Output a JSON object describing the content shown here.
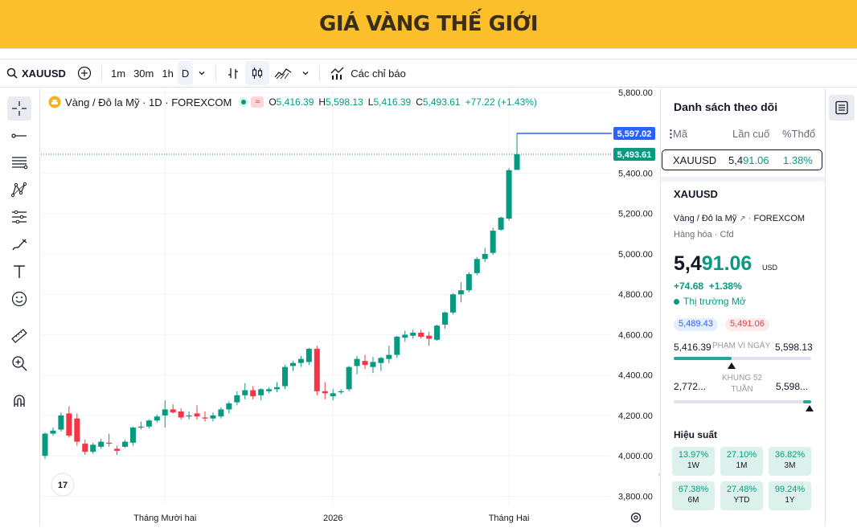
{
  "banner": {
    "title": "GIÁ VÀNG THẾ GIỚI"
  },
  "toolbar": {
    "symbol": "XAUUSD",
    "intervals": [
      "1m",
      "30m",
      "1h",
      "D"
    ],
    "active_interval": "D",
    "indicators_label": "Các chỉ báo"
  },
  "legend": {
    "title": "Vàng / Đô la Mỹ · 1D · FOREXCOM",
    "o_label": "O",
    "o": "5,416.39",
    "h_label": "H",
    "h": "5,598.13",
    "l_label": "L",
    "l": "5,416.39",
    "c_label": "C",
    "c": "5,493.61",
    "change": "+77.22 (+1.43%)"
  },
  "colors": {
    "up": "#089981",
    "down": "#f23645",
    "high_line": "#2962ff",
    "banner": "#fbbf2b"
  },
  "chart_data": {
    "type": "candlestick",
    "ylim": [
      3750,
      5820
    ],
    "y_ticks": [
      3800,
      4000,
      4200,
      4400,
      4600,
      4800,
      5000,
      5200,
      5400,
      5800
    ],
    "y_tick_labels": [
      "3,800.00",
      "4,000.00",
      "4,200.00",
      "4,400.00",
      "4,600.00",
      "4,800.00",
      "5,000.00",
      "5,200.00",
      "5,400.00",
      "5,800.00"
    ],
    "x_labels": [
      {
        "label": "Tháng Mười hai",
        "index": 15
      },
      {
        "label": "2026",
        "index": 36
      },
      {
        "label": "Tháng Hai",
        "index": 58
      }
    ],
    "price_markers": [
      {
        "label": "5,597.02",
        "value": 5597,
        "color": "#2962ff",
        "kind": "line"
      },
      {
        "label": "5,493.61",
        "value": 5493.6,
        "color": "#089981",
        "kind": "dotted"
      }
    ],
    "ohlc": [
      [
        4000,
        4115,
        3985,
        4110
      ],
      [
        4110,
        4140,
        4100,
        4125
      ],
      [
        4130,
        4215,
        4120,
        4200
      ],
      [
        4210,
        4245,
        4090,
        4100
      ],
      [
        4185,
        4210,
        4050,
        4070
      ],
      [
        4060,
        4080,
        4005,
        4020
      ],
      [
        4020,
        4065,
        4010,
        4055
      ],
      [
        4045,
        4085,
        4035,
        4070
      ],
      [
        4065,
        4110,
        4045,
        4060
      ],
      [
        4035,
        4050,
        4005,
        4025
      ],
      [
        4045,
        4080,
        4040,
        4070
      ],
      [
        4065,
        4145,
        4050,
        4140
      ],
      [
        4140,
        4170,
        4130,
        4145
      ],
      [
        4145,
        4180,
        4135,
        4175
      ],
      [
        4175,
        4205,
        4165,
        4195
      ],
      [
        4200,
        4275,
        4140,
        4230
      ],
      [
        4230,
        4255,
        4210,
        4215
      ],
      [
        4220,
        4235,
        4180,
        4190
      ],
      [
        4195,
        4220,
        4180,
        4200
      ],
      [
        4210,
        4250,
        4180,
        4195
      ],
      [
        4190,
        4220,
        4170,
        4185
      ],
      [
        4185,
        4215,
        4170,
        4200
      ],
      [
        4195,
        4240,
        4185,
        4230
      ],
      [
        4230,
        4270,
        4210,
        4260
      ],
      [
        4265,
        4320,
        4250,
        4300
      ],
      [
        4300,
        4360,
        4280,
        4325
      ],
      [
        4325,
        4345,
        4280,
        4295
      ],
      [
        4300,
        4335,
        4275,
        4330
      ],
      [
        4320,
        4340,
        4310,
        4330
      ],
      [
        4330,
        4365,
        4315,
        4340
      ],
      [
        4345,
        4450,
        4330,
        4440
      ],
      [
        4445,
        4470,
        4420,
        4460
      ],
      [
        4460,
        4495,
        4440,
        4480
      ],
      [
        4465,
        4535,
        4450,
        4530
      ],
      [
        4530,
        4545,
        4300,
        4320
      ],
      [
        4320,
        4365,
        4280,
        4310
      ],
      [
        4295,
        4330,
        4275,
        4310
      ],
      [
        4315,
        4330,
        4305,
        4320
      ],
      [
        4330,
        4445,
        4320,
        4440
      ],
      [
        4445,
        4495,
        4405,
        4480
      ],
      [
        4470,
        4500,
        4430,
        4450
      ],
      [
        4440,
        4490,
        4410,
        4465
      ],
      [
        4460,
        4490,
        4420,
        4485
      ],
      [
        4480,
        4545,
        4460,
        4500
      ],
      [
        4500,
        4595,
        4485,
        4590
      ],
      [
        4585,
        4620,
        4565,
        4600
      ],
      [
        4595,
        4625,
        4580,
        4610
      ],
      [
        4610,
        4625,
        4580,
        4590
      ],
      [
        4595,
        4615,
        4545,
        4580
      ],
      [
        4575,
        4650,
        4570,
        4645
      ],
      [
        4650,
        4715,
        4630,
        4710
      ],
      [
        4710,
        4805,
        4700,
        4800
      ],
      [
        4800,
        4860,
        4760,
        4820
      ],
      [
        4820,
        4910,
        4810,
        4900
      ],
      [
        4905,
        4985,
        4895,
        4975
      ],
      [
        4975,
        5030,
        4960,
        5000
      ],
      [
        5005,
        5130,
        4995,
        5115
      ],
      [
        5120,
        5185,
        5115,
        5180
      ],
      [
        5175,
        5425,
        5165,
        5415
      ],
      [
        5416.39,
        5598.13,
        5416.39,
        5493.61
      ]
    ]
  },
  "watchlist": {
    "title": "Danh sách theo dõi",
    "col_symbol": "Mã",
    "col_last": "Lần cuố",
    "col_change": "%Thđổ",
    "rows": [
      {
        "symbol": "XAUUSD",
        "last_a": "5,4",
        "last_b": "91.06",
        "change": "1.38%"
      }
    ]
  },
  "details": {
    "symbol": "XAUUSD",
    "description": "Vàng / Đô la Mỹ",
    "exchange": "FOREXCOM",
    "type_a": "Hàng hóa",
    "type_b": "Cfd",
    "price_a": "5,4",
    "price_b": "91.06",
    "currency": "USD",
    "change_abs": "+74.68",
    "change_pct": "+1.38%",
    "market_status": "Thị trường Mở",
    "bid": "5,489.43",
    "ask": "5,491.06",
    "day_low": "5,416.39",
    "day_range_label": "PHẠM VI NGÀY",
    "day_high": "5,598.13",
    "day_position": 0.42,
    "w52_low": "2,772...",
    "w52_label_a": "KHUNG 52",
    "w52_label_b": "TUẦN",
    "w52_high": "5,598...",
    "w52_position": 0.99,
    "perf_title": "Hiệu suất",
    "perf": [
      {
        "pct": "13.97%",
        "label": "1W"
      },
      {
        "pct": "27.10%",
        "label": "1M"
      },
      {
        "pct": "36.82%",
        "label": "3M"
      },
      {
        "pct": "67.38%",
        "label": "6M"
      },
      {
        "pct": "27.48%",
        "label": "YTD"
      },
      {
        "pct": "99.24%",
        "label": "1Y"
      }
    ]
  }
}
